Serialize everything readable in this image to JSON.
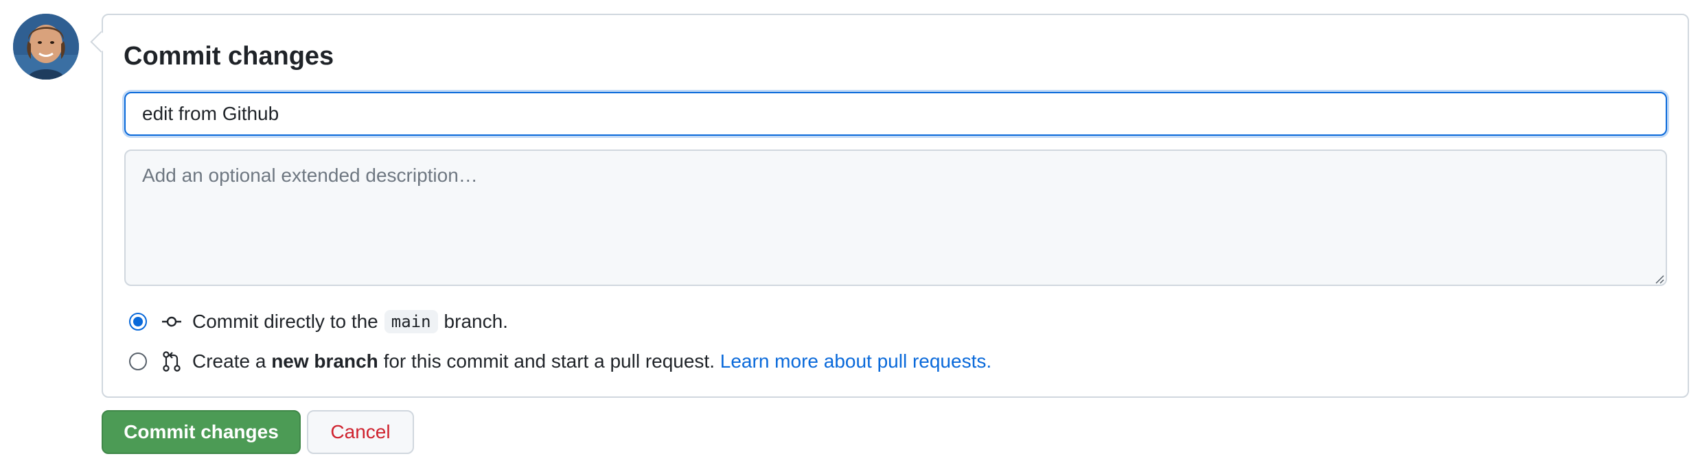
{
  "commit_form": {
    "title": "Commit changes",
    "summary_value": "edit from Github",
    "description_placeholder": "Add an optional extended description…",
    "option_direct": {
      "prefix": "Commit directly to the",
      "branch": "main",
      "suffix": "branch.",
      "selected": true
    },
    "option_new_branch": {
      "prefix": "Create a",
      "bold": "new branch",
      "suffix": "for this commit and start a pull request.",
      "link": "Learn more about pull requests.",
      "selected": false
    }
  },
  "buttons": {
    "commit_label": "Commit changes",
    "cancel_label": "Cancel"
  },
  "icons": {
    "avatar": "user-avatar",
    "commit": "git-commit-icon",
    "pull_request": "git-pull-request-icon"
  },
  "colors": {
    "accent": "#0969da",
    "primary_button": "#4c9b55",
    "danger_text": "#cf222e",
    "border": "#d0d7de"
  }
}
